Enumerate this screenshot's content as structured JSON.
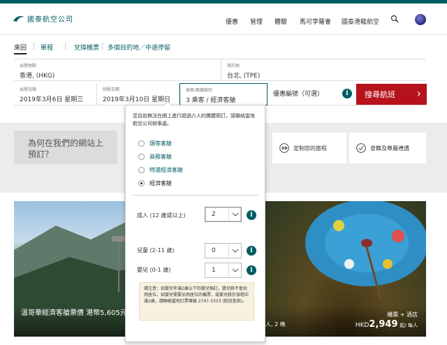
{
  "brand": {
    "name": "國泰航空公司",
    "color": "#005d63"
  },
  "nav": {
    "items": [
      "優惠",
      "管理",
      "體驗",
      "馬可孛羅會",
      "國泰港龍航空"
    ],
    "search_icon": "search-icon"
  },
  "tabs": {
    "items": [
      "來回",
      "單程",
      "兌換機票",
      "多個目的地／中途停留"
    ]
  },
  "form": {
    "from_label": "出發地點",
    "from_value": "香港, (HKG)",
    "to_label": "目的地",
    "to_value": "台北, (TPE)",
    "depart_label": "出發日期",
    "depart_value": "2019年3月6日 星期三",
    "return_label": "回程日期",
    "return_value": "2019年3月10日 星期日",
    "pax_label": "乘客/客艙級別",
    "pax_value": "3 乘客 / 經濟客艙",
    "promo_placeholder": "優惠編號（可選）",
    "search_label": "搜尋航班",
    "search_color": "#b5121b"
  },
  "why": {
    "title": "為何在我們的網站上預訂？"
  },
  "features": [
    {
      "icon": "plane-icon",
      "label": "定制您的旅程"
    },
    {
      "icon": "check-circle-icon",
      "label": "會籍及尊屬禮遇"
    }
  ],
  "popup": {
    "note": "您目前無法在網上進行超過六人的團體預訂，請聯絡當地航空公司辦事處。",
    "cabins": [
      "頭等客艙",
      "商務客艙",
      "特選經濟客艙",
      "經濟客艙"
    ],
    "selected_cabin": "經濟客艙",
    "adults_label": "成人 (12 歲或以上)",
    "adults_value": "2",
    "children_label": "兒童 (2-11 歲)",
    "children_value": "0",
    "infants_label": "嬰兒 (0-1 歲)",
    "infants_value": "1",
    "notice": "請注意：如嬰兒年滿2歲以下的嬰兒預訂，嬰兒將不會佔用座位。如嬰兒需要佔用座位的機票，或嬰兒將於旅程中滿2歲，請聯絡當地訂票專線 2747-3333 (航班查詢)。"
  },
  "promos": {
    "left_caption": "溫哥華經濟客艙票價 港幣5,605元起",
    "right_tag": "機票 + 酒店",
    "right_sub": "人, 2 晚",
    "right_currency": "HKD",
    "right_price": "2,949",
    "right_unit": "起/ 每人"
  }
}
